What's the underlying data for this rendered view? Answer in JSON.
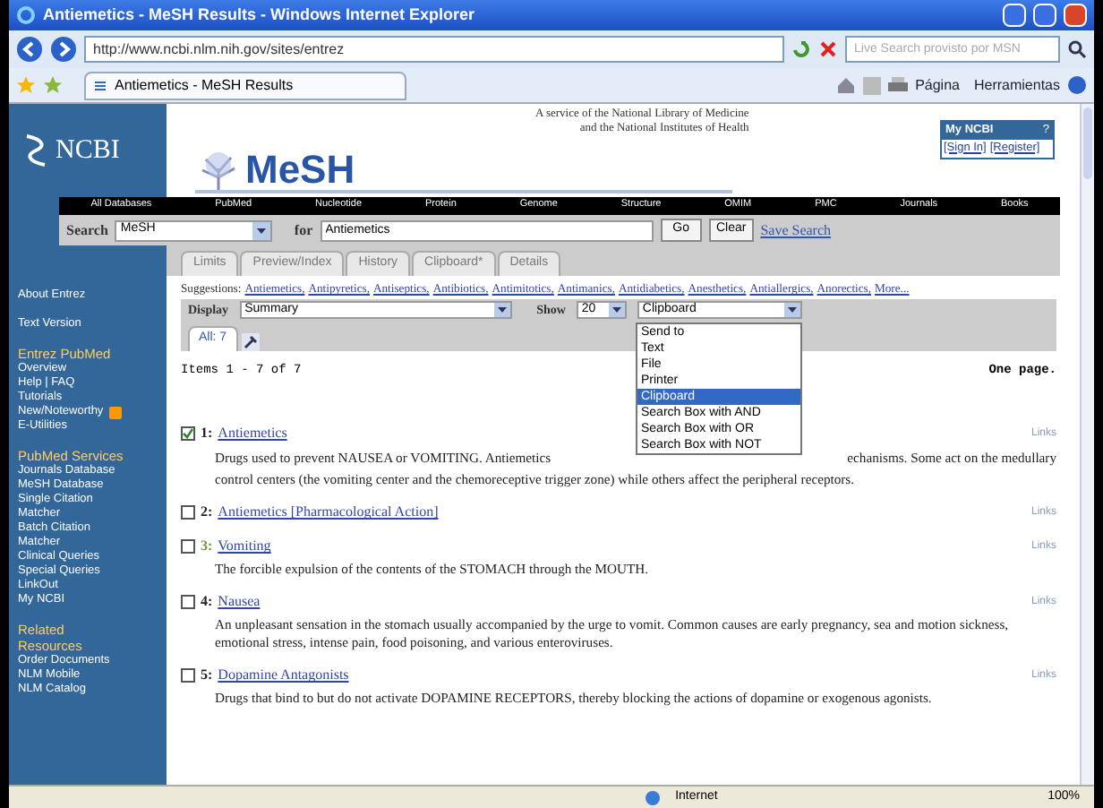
{
  "window": {
    "title": "Antiemetics - MeSH Results - Windows Internet Explorer"
  },
  "address_bar": {
    "value": "http://www.ncbi.nlm.nih.gov/sites/entrez",
    "search_placeholder": "Live Search provisto por MSN"
  },
  "browser_tab": {
    "label": "Antiemetics - MeSH Results"
  },
  "command_bar": [
    {
      "label": "Página"
    },
    {
      "label": "Herramientas"
    }
  ],
  "header": {
    "logo": "NCBI",
    "db_logo": "MeSH",
    "service_line_1": "A service of the National Library of Medicine",
    "service_line_2": "and the National Institutes of Health",
    "my_ncbi": "My NCBI",
    "my_ncbi_help": "?",
    "sign_in": "[Sign In]",
    "register": "[Register]"
  },
  "nav": [
    "All Databases",
    "PubMed",
    "Nucleotide",
    "Protein",
    "Genome",
    "Structure",
    "OMIM",
    "PMC",
    "Journals",
    "Books"
  ],
  "search": {
    "label": "Search",
    "database": "MeSH",
    "for_label": "for",
    "query": "Antiemetics",
    "go": "Go",
    "clear": "Clear",
    "save": "Save Search"
  },
  "tabs": [
    {
      "label": "Limits",
      "selected": false
    },
    {
      "label": "Preview/Index",
      "selected": false
    },
    {
      "label": "History",
      "selected": false
    },
    {
      "label": "Clipboard*",
      "selected": false
    },
    {
      "label": "Details",
      "selected": false
    }
  ],
  "sidebar": [
    {
      "kind": "link",
      "label": "About Entrez"
    },
    {
      "kind": "gap"
    },
    {
      "kind": "link",
      "label": "Text Version"
    },
    {
      "kind": "gap"
    },
    {
      "kind": "heading",
      "label": "Entrez PubMed"
    },
    {
      "kind": "link",
      "label": "Overview"
    },
    {
      "kind": "link",
      "label": "Help | FAQ"
    },
    {
      "kind": "link",
      "label": "Tutorials"
    },
    {
      "kind": "rss",
      "label": "New/Noteworthy"
    },
    {
      "kind": "link",
      "label": "E-Utilities"
    },
    {
      "kind": "gap"
    },
    {
      "kind": "heading",
      "label": "PubMed Services"
    },
    {
      "kind": "link",
      "label": "Journals Database"
    },
    {
      "kind": "link",
      "label": "MeSH Database"
    },
    {
      "kind": "link",
      "label": "Single Citation"
    },
    {
      "kind": "link",
      "label": "Matcher"
    },
    {
      "kind": "link",
      "label": "Batch Citation"
    },
    {
      "kind": "link",
      "label": "Matcher"
    },
    {
      "kind": "link",
      "label": "Clinical Queries"
    },
    {
      "kind": "link",
      "label": "Special Queries"
    },
    {
      "kind": "link",
      "label": "LinkOut"
    },
    {
      "kind": "link",
      "label": "My NCBI"
    },
    {
      "kind": "gap"
    },
    {
      "kind": "heading",
      "label": "Related"
    },
    {
      "kind": "heading",
      "label": "Resources"
    },
    {
      "kind": "link",
      "label": "Order Documents"
    },
    {
      "kind": "link",
      "label": "NLM Mobile"
    },
    {
      "kind": "link",
      "label": "NLM Catalog"
    }
  ],
  "suggestions": {
    "label": "Suggestions:",
    "items": [
      "Antiemetics,",
      "Antipyretics,",
      "Antiseptics,",
      "Antibiotics,",
      "Antimitotics,",
      "Antimanics,",
      "Antidiabetics,",
      "Anesthetics,",
      "Antiallergics,",
      "Anorectics,",
      "More..."
    ]
  },
  "display": {
    "label": "Display",
    "format": "Summary",
    "show_label": "Show",
    "show_value": "20",
    "send_value": "Clipboard"
  },
  "send_menu": [
    {
      "label": "Send to",
      "selected": false
    },
    {
      "label": "Text",
      "selected": false
    },
    {
      "label": "File",
      "selected": false
    },
    {
      "label": "Printer",
      "selected": false
    },
    {
      "label": "Clipboard",
      "selected": true
    },
    {
      "label": "Search Box with AND",
      "selected": false
    },
    {
      "label": "Search Box with OR",
      "selected": false
    },
    {
      "label": "Search Box with NOT",
      "selected": false
    }
  ],
  "result_tab": {
    "label": "All: 7"
  },
  "items_count": "Items 1 - 7 of 7",
  "page_info": "One page.",
  "results": [
    {
      "number": "1:",
      "title": "Antiemetics",
      "checked": true,
      "visited": false,
      "links": "Links",
      "description_before_menu": "Drugs used to prevent NAUSEA or VOMITING. Antiemetics",
      "description_after_menu": "echanisms. Some act on the medullary",
      "description": "control centers (the vomiting center and the chemoreceptive trigger zone) while others affect the peripheral receptors."
    },
    {
      "number": "2:",
      "title": "Antiemetics [Pharmacological Action]",
      "checked": false,
      "visited": false,
      "links": "Links"
    },
    {
      "number": "3:",
      "title": "Vomiting",
      "checked": false,
      "visited": true,
      "links": "Links",
      "description": "The forcible expulsion of the contents of the STOMACH through the MOUTH."
    },
    {
      "number": "4:",
      "title": "Nausea",
      "checked": false,
      "visited": false,
      "links": "Links",
      "description": "An unpleasant sensation in the stomach usually accompanied by the urge to vomit. Common causes are early pregnancy, sea and motion sickness, emotional stress, intense pain, food poisoning, and various enteroviruses."
    },
    {
      "number": "5:",
      "title": "Dopamine Antagonists",
      "checked": false,
      "visited": false,
      "links": "Links",
      "description": "Drugs that bind to but do not activate DOPAMINE RECEPTORS, thereby blocking the actions of dopamine or exogenous agonists."
    }
  ],
  "status_bar": {
    "zone": "Internet",
    "zoom": "100%"
  }
}
